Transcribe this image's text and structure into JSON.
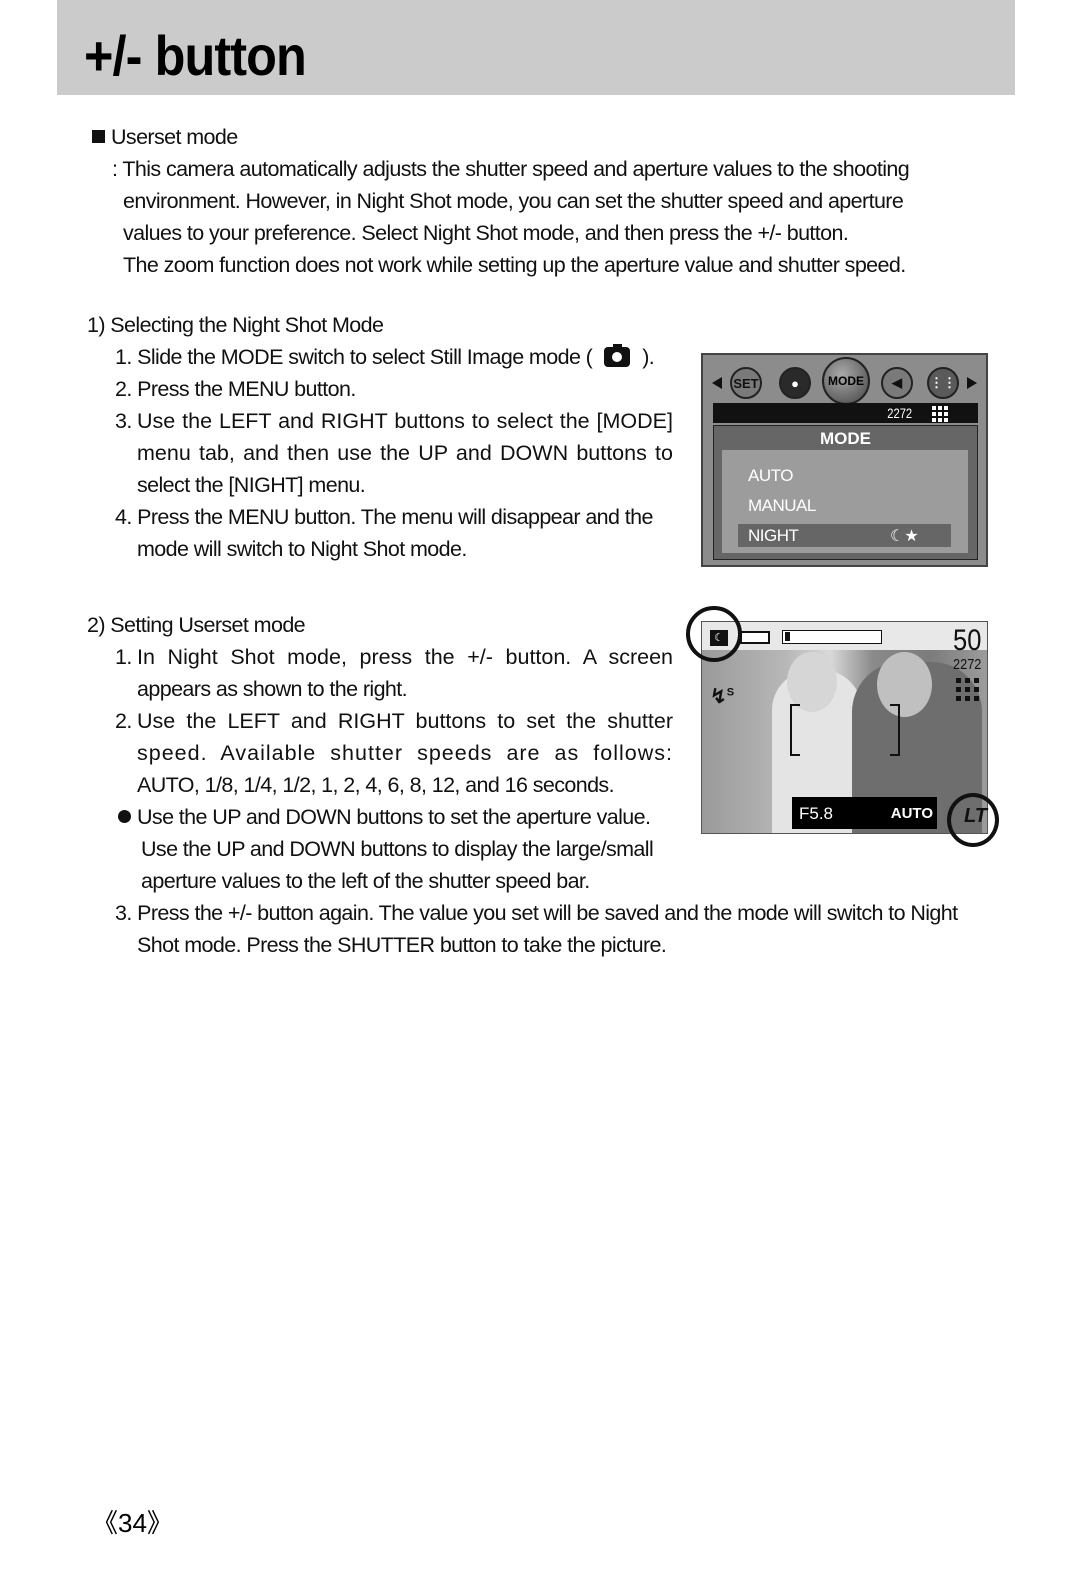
{
  "header": {
    "title": "+/- button"
  },
  "section": {
    "heading": "Userset mode",
    "intro": [
      ": This camera automatically adjusts the shutter speed and aperture values to the shooting",
      "environment. However, in Night Shot mode, you can set the shutter speed and aperture",
      "values to your preference. Select Night Shot mode, and then press the +/- button.",
      "The zoom function does not work while setting up the aperture value and shutter speed."
    ]
  },
  "part1": {
    "heading": "1) Selecting the Night Shot Mode",
    "steps": [
      {
        "num": "1.",
        "lines": [
          "Slide the MODE switch to select Still Image mode (",
          ")."
        ]
      },
      {
        "num": "2.",
        "lines": [
          "Press the MENU button."
        ]
      },
      {
        "num": "3.",
        "lines": [
          "Use the LEFT and RIGHT buttons to select the [MODE]",
          "menu tab, and then use the UP and DOWN buttons to",
          "select the [NIGHT] menu."
        ]
      },
      {
        "num": "4.",
        "lines": [
          "Press the MENU button. The menu will disappear and the",
          "mode will switch to Night Shot mode."
        ]
      }
    ]
  },
  "part2": {
    "heading": "2) Setting Userset mode",
    "steps": [
      {
        "num": "1.",
        "lines": [
          "In Night Shot mode, press the +/- button. A screen",
          "appears as shown to the right."
        ]
      },
      {
        "num": "2.",
        "lines": [
          "Use the LEFT and RIGHT buttons to set the shutter",
          "speed. Available shutter speeds are as follows:",
          "AUTO, 1/8, 1/4, 1/2, 1, 2, 4, 6, 8, 12, and 16 seconds."
        ]
      },
      {
        "num": "3.",
        "lines": [
          "Press the +/- button again. The value you set will be saved and the mode will switch to Night",
          "Shot mode. Press the SHUTTER button to take the picture."
        ]
      }
    ],
    "bullet": [
      "Use the UP and DOWN buttons to set the aperture value.",
      "Use the UP and DOWN buttons to display the large/small",
      "aperture values to the left of the shutter speed bar."
    ]
  },
  "screen_menu": {
    "tabs": [
      "SET",
      "person-camera",
      "MODE",
      "sound",
      "grid"
    ],
    "resolution": "2272",
    "panel_title": "MODE",
    "items": [
      "AUTO",
      "MANUAL",
      "NIGHT"
    ],
    "selected": "NIGHT",
    "moon_glyph": "☾★"
  },
  "screen_live": {
    "shots_remaining": "50",
    "resolution": "2272",
    "flash_label": "S",
    "aperture": "F5.8",
    "shutter": "AUTO",
    "shutter_bar_level": 0.05,
    "stabilizer_label": "LT",
    "moon_glyph": "☾"
  },
  "footer": {
    "page_number": "《34》"
  }
}
